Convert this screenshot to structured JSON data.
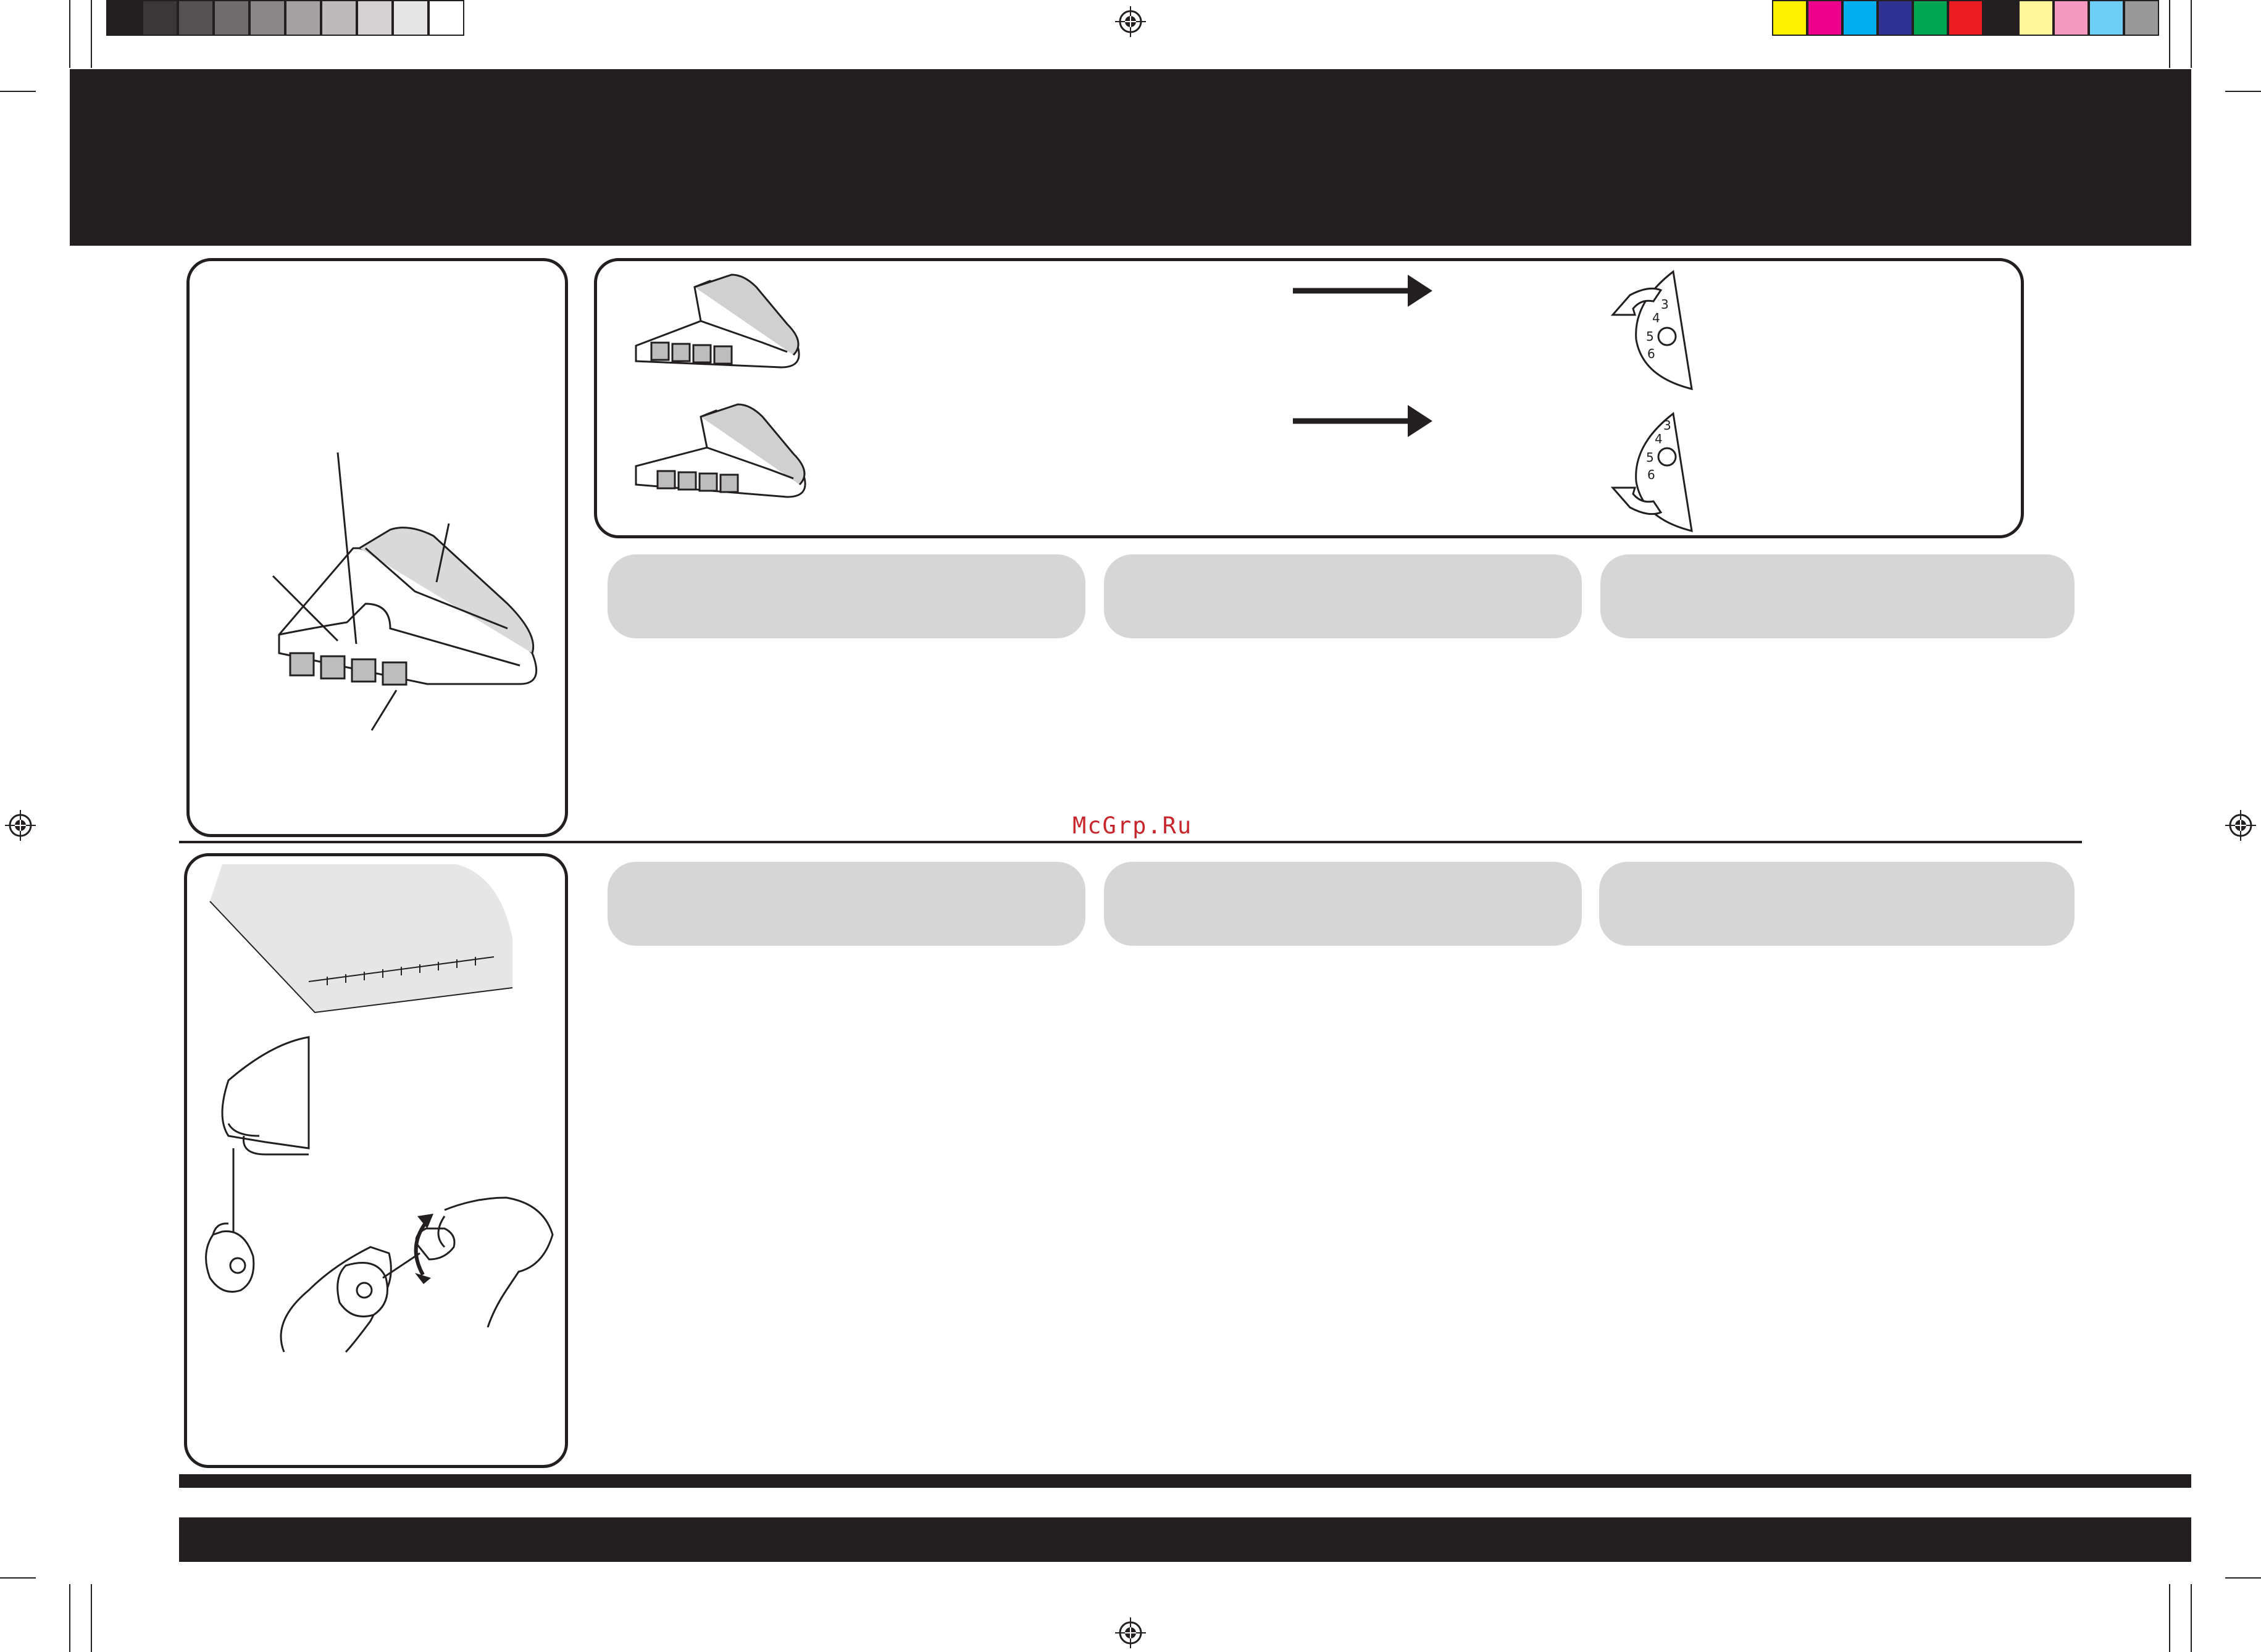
{
  "watermark": "McGrp.Ru",
  "colors": {
    "ink": "#231f20",
    "pill_gray": "#d6d6d6",
    "watermark_red": "#c8262c",
    "grayscale_bar": [
      "#231f20",
      "#3a3738",
      "#555253",
      "#6f6c6d",
      "#8a8788",
      "#a3a1a2",
      "#bcbaba",
      "#d3d1d1",
      "#e6e5e5",
      "#ffffff"
    ],
    "color_bar": [
      "#fff200",
      "#ec008c",
      "#00aeef",
      "#2e3192",
      "#00a651",
      "#ed1c24",
      "#231f20",
      "#fff799",
      "#f49ac1",
      "#6dcff6",
      "#999999"
    ]
  },
  "figures": {
    "hem_diagram": "hem-fabric-diagram",
    "stitch_width_dial": "stitch-width-dial-icon",
    "bobbin_thread": "bobbin-case-tension-illustration",
    "fabric_sample": "fabric-sample-stitch-illustration"
  },
  "dial_numbers": [
    "3",
    "4",
    "5",
    "6"
  ]
}
